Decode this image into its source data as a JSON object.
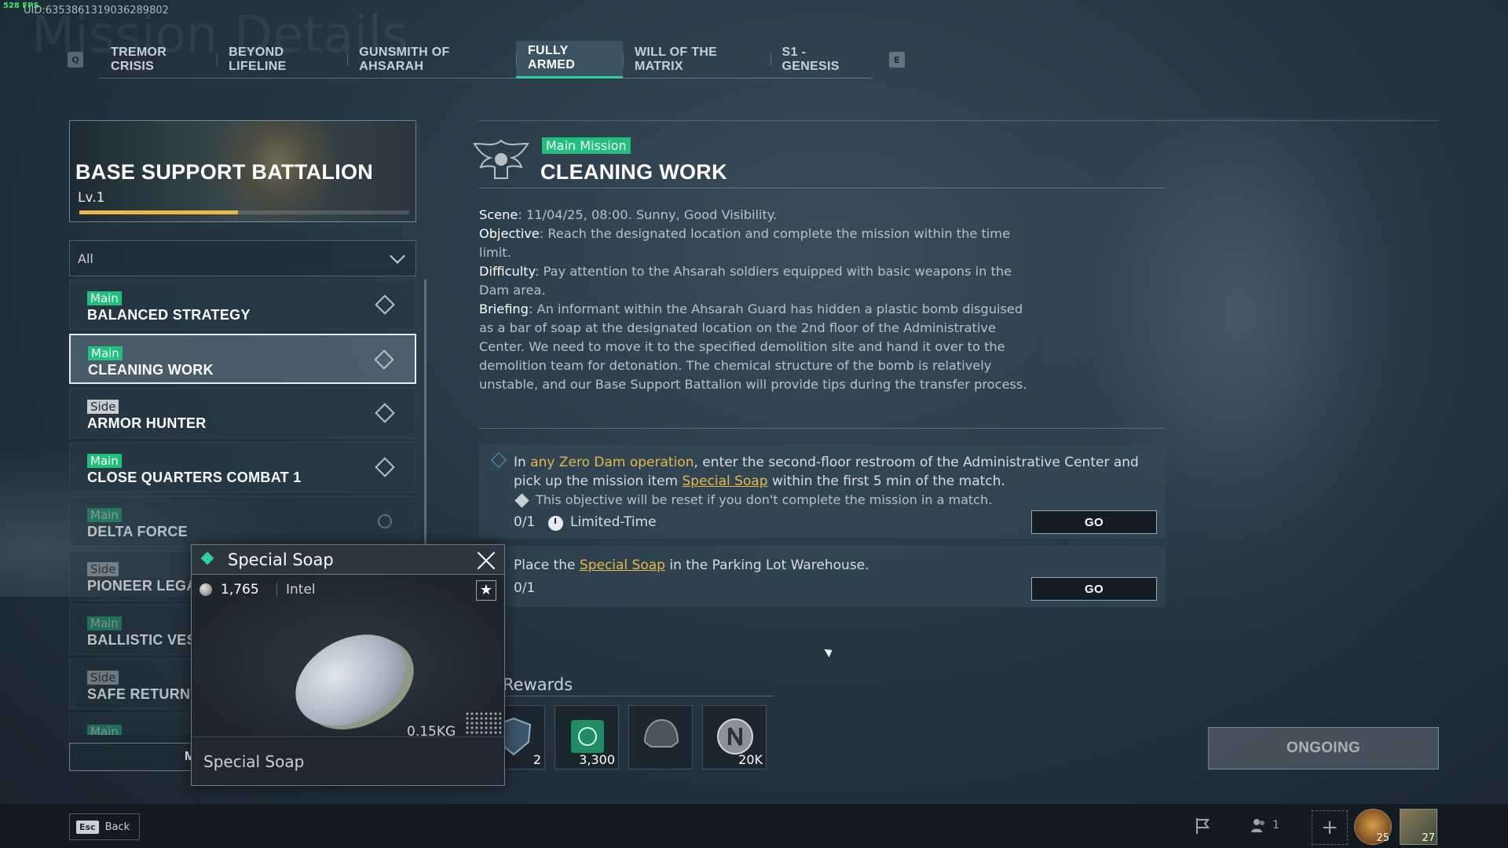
{
  "debug": {
    "fps": "528 FPS",
    "uid": "UID:6353861319036289802"
  },
  "background_title": "Mission Details",
  "tabs": {
    "prev_key": "Q",
    "next_key": "E",
    "items": [
      {
        "label": "TREMOR CRISIS"
      },
      {
        "label": "BEYOND LIFELINE"
      },
      {
        "label": "GUNSMITH OF AHSARAH"
      },
      {
        "label": "FULLY ARMED",
        "active": true
      },
      {
        "label": "WILL OF THE MATRIX"
      },
      {
        "label": "S1 - GENESIS"
      }
    ]
  },
  "battalion": {
    "title": "BASE SUPPORT BATTALION",
    "level": "Lv.1",
    "progress": 0.48,
    "accent": "#e7b94a"
  },
  "filter": {
    "value": "All"
  },
  "missions": [
    {
      "type": "Main",
      "name": "BALANCED STRATEGY"
    },
    {
      "type": "Main",
      "name": "CLEANING WORK",
      "selected": true
    },
    {
      "type": "Side",
      "name": "ARMOR HUNTER"
    },
    {
      "type": "Main",
      "name": "CLOSE QUARTERS COMBAT 1"
    },
    {
      "type": "Main",
      "name": "DELTA FORCE",
      "done": true
    },
    {
      "type": "Side",
      "name": "PIONEER LEGA",
      "done": true
    },
    {
      "type": "Main",
      "name": "BALLISTIC VES",
      "done": true
    },
    {
      "type": "Side",
      "name": "SAFE RETURN",
      "done": true
    },
    {
      "type": "Main",
      "name": "",
      "done": true
    }
  ],
  "left_bottom_button": "M",
  "tooltip": {
    "title": "Special Soap",
    "price": "1,765",
    "category": "Intel",
    "star": "★",
    "weight": "0.15KG",
    "footer": "Special Soap"
  },
  "detail": {
    "tag": "Main Mission",
    "title": "CLEANING WORK",
    "scene_label": "Scene",
    "scene": ": 11/04/25, 08:00. Sunny, Good Visibility.",
    "objective_label": "Objective",
    "objective": ": Reach the designated location and complete the mission within the time limit.",
    "difficulty_label": "Difficulty",
    "difficulty": ": Pay attention to the Ahsarah soldiers equipped with basic weapons in the Dam area.",
    "briefing_label": "Briefing",
    "briefing": ": An informant within the Ahsarah Guard has hidden a plastic bomb disguised as a bar of soap at the designated location on the 2nd floor of the Administrative Center. We need to move it to the specified demolition site and hand it over to the demolition team for detonation. The chemical structure of the bomb is relatively unstable, and our Base Support Battalion will provide tips during the transfer process."
  },
  "objective1": {
    "pre": "In ",
    "highlight": "any Zero Dam operation",
    "mid": ", enter the second-floor restroom of the Administrative Center and pick up the mission item ",
    "item": "Special Soap",
    "post": " within the first 5 min of the match.",
    "warning": "This objective will be reset if you don't complete the mission in a match.",
    "progress": "0/1",
    "limit": "Limited-Time",
    "go": "GO"
  },
  "objective2": {
    "pre": "Place the ",
    "item": "Special Soap",
    "post": " in the Parking Lot Warehouse.",
    "progress": "0/1",
    "go": "GO"
  },
  "rewards": {
    "label": "Rewards",
    "items": [
      {
        "icon": "shield-badge-icon",
        "qty": "2"
      },
      {
        "icon": "green-crate-icon",
        "qty": "3,300"
      },
      {
        "icon": "helmet-icon",
        "qty": ""
      },
      {
        "icon": "silver-coin-icon",
        "qty": "20K"
      }
    ]
  },
  "status_button": "ONGOING",
  "bottom": {
    "esc": "Esc",
    "back": "Back",
    "party_count": "1",
    "plus": "+",
    "avatar1_level": "25",
    "avatar2_level": "27"
  }
}
